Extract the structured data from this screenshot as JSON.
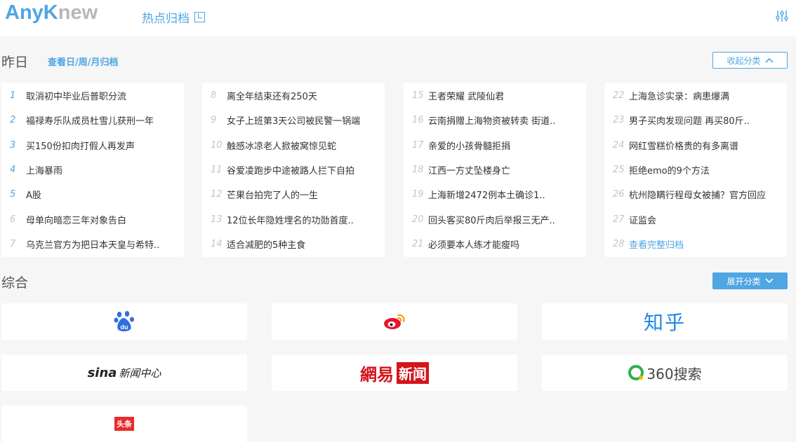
{
  "header": {
    "logo_part1": "Any",
    "logo_part2": "K",
    "logo_part3": "new",
    "archive_link": "热点归档",
    "settings_icon": "sliders-icon"
  },
  "yesterday": {
    "title": "昨日",
    "archive_link": "查看日/周/月归档",
    "collapse_button": "收起分类",
    "columns": [
      [
        {
          "num": "1",
          "text": "取消初中毕业后普职分流"
        },
        {
          "num": "2",
          "text": "福禄寿乐队成员杜雪儿获刑一年"
        },
        {
          "num": "3",
          "text": "买150份扣肉打假人再发声"
        },
        {
          "num": "4",
          "text": "上海暴雨"
        },
        {
          "num": "5",
          "text": "A股"
        },
        {
          "num": "6",
          "text": "母单向暗恋三年对象告白"
        },
        {
          "num": "7",
          "text": "乌克兰官方为把日本天皇与希特.."
        }
      ],
      [
        {
          "num": "8",
          "text": "离全年结束还有250天"
        },
        {
          "num": "9",
          "text": "女子上班第3天公司被民警一锅端"
        },
        {
          "num": "10",
          "text": "触感冰凉老人掀被窝惊见蛇"
        },
        {
          "num": "11",
          "text": "谷爱凌跑步中途被路人拦下自拍"
        },
        {
          "num": "12",
          "text": "芒果台拍完了人的一生"
        },
        {
          "num": "13",
          "text": "12位长年隐姓埋名的功勋首度.."
        },
        {
          "num": "14",
          "text": "适合减肥的5种主食"
        }
      ],
      [
        {
          "num": "15",
          "text": "王者荣耀 武陵仙君"
        },
        {
          "num": "16",
          "text": "云南捐赠上海物资被转卖 街道.."
        },
        {
          "num": "17",
          "text": "亲爱的小孩骨髓拒捐"
        },
        {
          "num": "18",
          "text": "江西一方丈坠楼身亡"
        },
        {
          "num": "19",
          "text": "上海新增2472例本土确诊1.."
        },
        {
          "num": "20",
          "text": "回头客买80斤肉后举报三无产.."
        },
        {
          "num": "21",
          "text": "必须要本人练才能瘦吗"
        }
      ],
      [
        {
          "num": "22",
          "text": "上海急诊实录：病患爆满"
        },
        {
          "num": "23",
          "text": "男子买肉发现问题 再买80斤.."
        },
        {
          "num": "24",
          "text": "网红雪糕价格贵的有多离谱"
        },
        {
          "num": "25",
          "text": "拒绝emo的9个方法"
        },
        {
          "num": "26",
          "text": "杭州隐瞒行程母女被捕？官方回应"
        },
        {
          "num": "27",
          "text": "证监会"
        },
        {
          "num": "28",
          "text": "查看完整归档"
        }
      ]
    ]
  },
  "general": {
    "title": "综合",
    "expand_button": "展开分类",
    "sources": {
      "baidu": "du",
      "weibo": "",
      "zhihu": "知乎",
      "sina_s": "sina",
      "sina_name": "新闻中心",
      "netease_a": "網易",
      "netease_b": "新闻",
      "s360": "360搜索",
      "toutiao": "头条"
    }
  },
  "colors": {
    "accent": "#4fa6e3",
    "muted_number": "#c5c5c5",
    "netease_red": "#d4141c",
    "zhihu_blue": "#1e88e5"
  }
}
